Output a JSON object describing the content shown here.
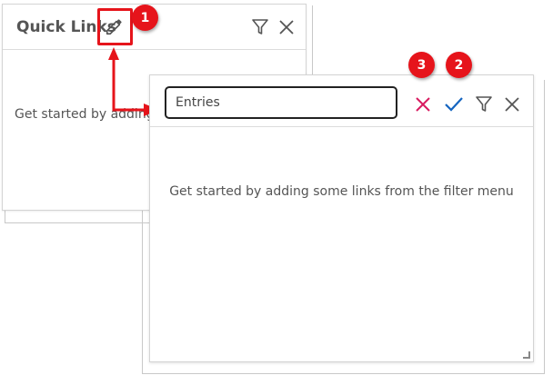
{
  "background_widget": {
    "title": "Quick Links",
    "body_text": "Get started by adding",
    "icons": [
      "pencil-icon",
      "filter-icon",
      "close-icon"
    ]
  },
  "editing_widget": {
    "name_input_value": "Entries",
    "body_text": "Get started by adding some links from the filter menu",
    "icons": [
      "cancel-x-icon",
      "confirm-check-icon",
      "filter-icon",
      "close-icon"
    ]
  },
  "callouts": [
    {
      "label": "1"
    },
    {
      "label": "2"
    },
    {
      "label": "3"
    }
  ],
  "colors": {
    "annotation_red": "#e6141b",
    "cancel_pink": "#d81b60",
    "confirm_blue": "#1565c0",
    "icon_gray": "#555555"
  }
}
